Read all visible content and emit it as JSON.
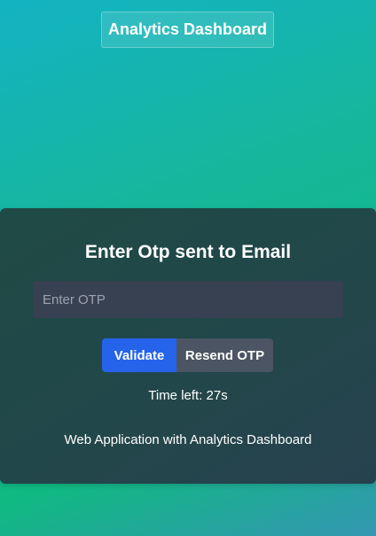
{
  "header": {
    "title": "Analytics Dashboard"
  },
  "otp_card": {
    "heading": "Enter Otp sent to Email",
    "input": {
      "placeholder": "Enter OTP",
      "value": ""
    },
    "validate_label": "Validate",
    "resend_label": "Resend OTP",
    "timer_text": "Time left: 27s",
    "footer_text": "Web Application with Analytics Dashboard"
  },
  "colors": {
    "primary_button": "#2563eb",
    "secondary_button": "#4b5563",
    "input_background": "#374151",
    "card_background": "#22474a"
  }
}
